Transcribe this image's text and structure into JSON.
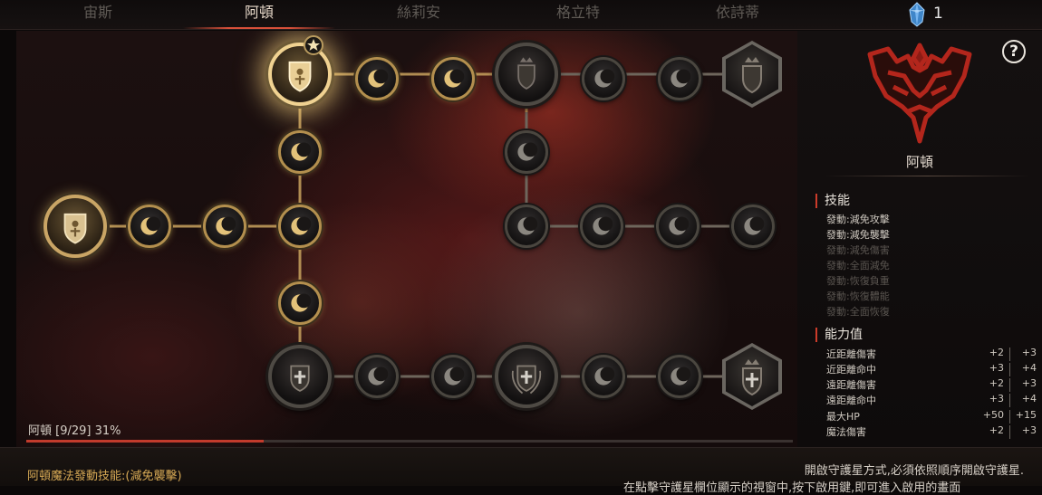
{
  "tabs": [
    {
      "label": "宙斯",
      "active": false
    },
    {
      "label": "阿頓",
      "active": true
    },
    {
      "label": "絲莉安",
      "active": false
    },
    {
      "label": "格立特",
      "active": false
    },
    {
      "label": "依詩蒂",
      "active": false
    }
  ],
  "currency": {
    "icon": "blue-crystal-icon",
    "count": "1"
  },
  "progress": {
    "label": "阿頓 [9/29] 31%",
    "fraction": 0.31
  },
  "panel": {
    "help": "?",
    "god_name": "阿頓",
    "skills_title": "技能",
    "skills": [
      {
        "label": "發動:減免攻擊",
        "unlocked": true
      },
      {
        "label": "發動:減免襲擊",
        "unlocked": true
      },
      {
        "label": "發動:減免傷害",
        "unlocked": false
      },
      {
        "label": "發動:全面減免",
        "unlocked": false
      },
      {
        "label": "發動:恢復負重",
        "unlocked": false
      },
      {
        "label": "發動:恢復體能",
        "unlocked": false
      },
      {
        "label": "發動:全面恢復",
        "unlocked": false
      }
    ],
    "stats_title": "能力值",
    "stats": [
      {
        "name": "近距離傷害",
        "current": "+2",
        "next": "+3"
      },
      {
        "name": "近距離命中",
        "current": "+3",
        "next": "+4"
      },
      {
        "name": "遠距離傷害",
        "current": "+2",
        "next": "+3"
      },
      {
        "name": "遠距離命中",
        "current": "+3",
        "next": "+4"
      },
      {
        "name": "最大HP",
        "current": "+50",
        "next": "+15"
      },
      {
        "name": "魔法傷害",
        "current": "+2",
        "next": "+3"
      }
    ]
  },
  "bottom": {
    "active_skill": "阿頓魔法發動技能:(減免襲擊)",
    "hint_line1": "開啟守護星方式,必須依照順序開啟守護星.",
    "hint_line2": "在點擊守護星欄位顯示的視窗中,按下啟用鍵,即可進入啟用的畫面"
  },
  "colors": {
    "accent": "#cc3b2a",
    "gold": "#c9a565",
    "active_skill": "#d7a955"
  }
}
